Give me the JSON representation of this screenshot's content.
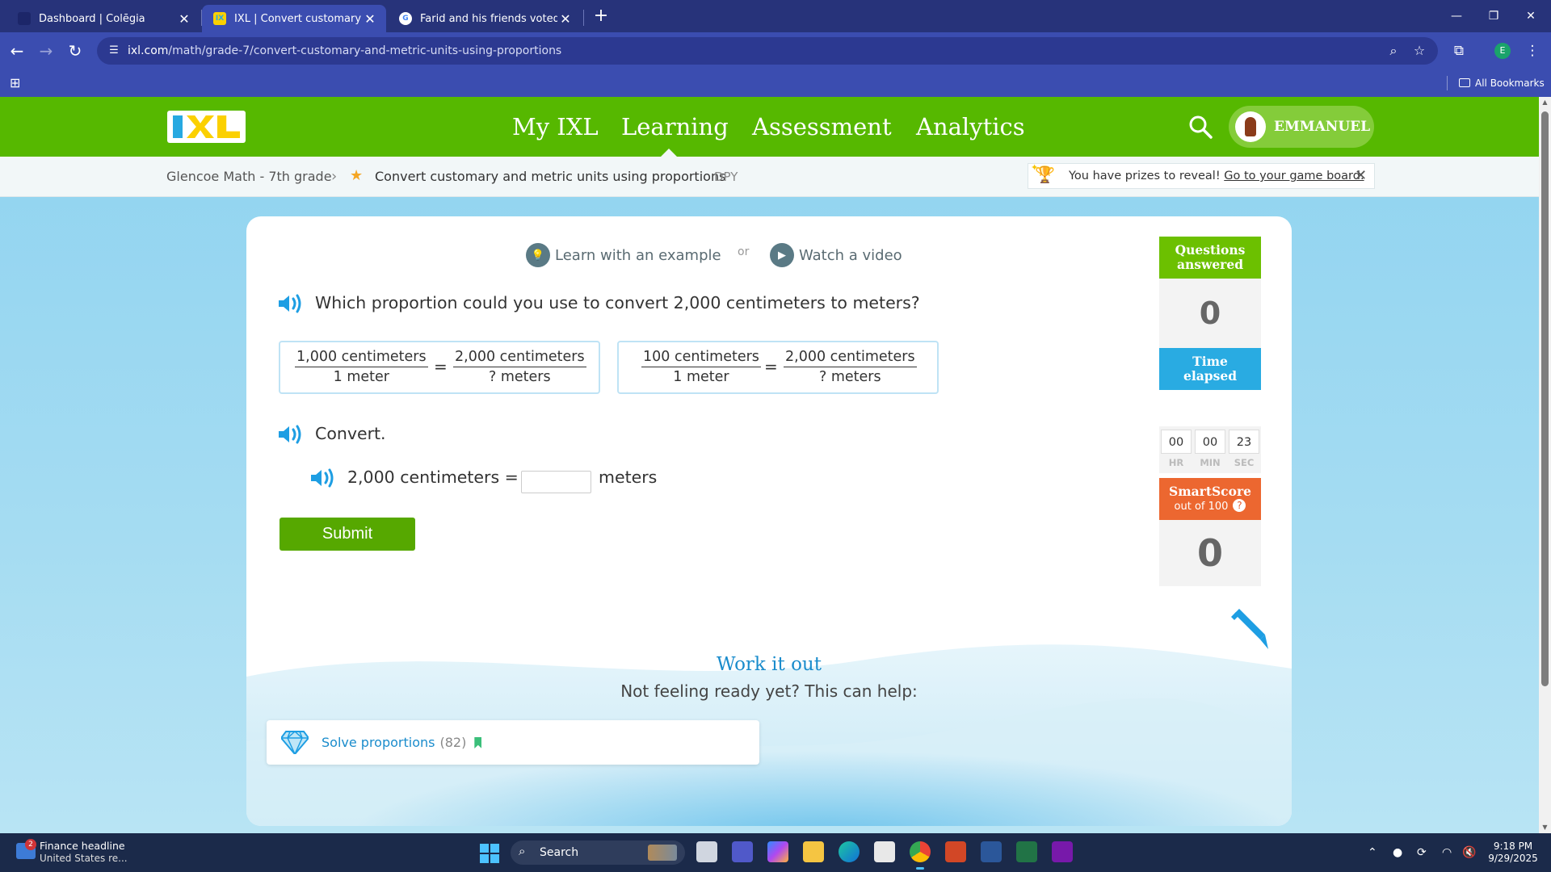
{
  "browser": {
    "tabs": [
      {
        "title": "Dashboard | Colēgia",
        "active": false
      },
      {
        "title": "IXL | Convert customary and me",
        "active": true
      },
      {
        "title": "Farid and his friends voted on th",
        "active": false
      }
    ],
    "url_host": "ixl.com",
    "url_path": "/math/grade-7/convert-customary-and-metric-units-using-proportions",
    "profile_initial": "E",
    "all_bookmarks": "All Bookmarks"
  },
  "ixl": {
    "nav": {
      "my_ixl": "My IXL",
      "learning": "Learning",
      "assessment": "Assessment",
      "analytics": "Analytics"
    },
    "user_name": "EMMANUEL",
    "breadcrumb": {
      "course": "Glencoe Math - 7th grade",
      "skill": "Convert customary and metric units using proportions",
      "code": "DPY"
    },
    "prizes": {
      "message": "You have prizes to reveal!",
      "link": "Go to your game board."
    },
    "helpers": {
      "learn": "Learn with an example",
      "or": "or",
      "video": "Watch a video"
    },
    "question": {
      "prompt": "Which proportion could you use to convert 2,000 centimeters to meters?",
      "choices": [
        {
          "left_num": "1,000 centimeters",
          "left_den": "1 meter",
          "right_num": "2,000 centimeters",
          "right_den": "? meters"
        },
        {
          "left_num": "100 centimeters",
          "left_den": "1 meter",
          "right_num": "2,000 centimeters",
          "right_den": "? meters"
        }
      ],
      "eq_sign": "=",
      "convert_label": "Convert.",
      "conversion_lhs": "2,000 centimeters =",
      "conversion_unit": "meters",
      "answer_value": "",
      "submit": "Submit"
    },
    "sidebar": {
      "questions_head_1": "Questions",
      "questions_head_2": "answered",
      "questions_value": "0",
      "time_head_1": "Time",
      "time_head_2": "elapsed",
      "hr": "00",
      "min": "00",
      "sec": "23",
      "hr_label": "HR",
      "min_label": "MIN",
      "sec_label": "SEC",
      "smart_head_1": "SmartScore",
      "smart_head_2": "out of 100",
      "smart_value": "0",
      "questions_color": "#6cc000",
      "time_color": "#29abe2",
      "smart_color": "#ec6730"
    },
    "work_it_out": "Work it out",
    "not_ready": "Not feeling ready yet? This can help:",
    "recommended": {
      "label": "Solve proportions",
      "count": "(82)"
    }
  },
  "taskbar": {
    "news_title": "Finance headline",
    "news_sub": "United States re...",
    "news_badge": "2",
    "search": "Search",
    "time": "9:18 PM",
    "date": "9/29/2025"
  }
}
